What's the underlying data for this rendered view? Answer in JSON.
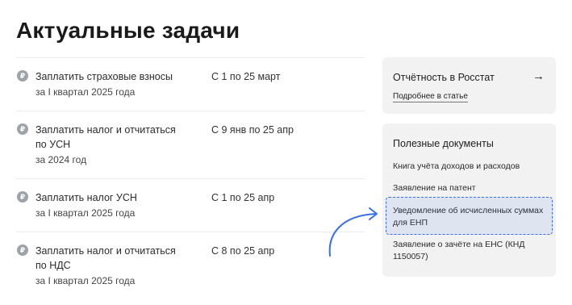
{
  "page": {
    "title": "Актуальные задачи"
  },
  "tasks": [
    {
      "title": "Заплатить страховые взносы",
      "subtitle": "за I квартал 2025 года",
      "deadline": "С 1 по 25 март"
    },
    {
      "title": "Заплатить налог и отчитаться по УСН",
      "subtitle": "за 2024 год",
      "deadline": "С 9 янв по 25 апр"
    },
    {
      "title": "Заплатить налог УСН",
      "subtitle": "за I квартал 2025 года",
      "deadline": "С 1 по 25 апр"
    },
    {
      "title": "Заплатить налог и отчитаться по НДС",
      "subtitle": "за I квартал 2025 года",
      "deadline": "С 8 по 25 апр"
    }
  ],
  "task_icon_glyph": "₽",
  "report_card": {
    "title": "Отчётность в Росстат",
    "link": "Подробнее в статье",
    "arrow": "→"
  },
  "docs_card": {
    "title": "Полезные документы",
    "items": [
      "Книга учёта доходов и расходов",
      "Заявление на патент",
      "Уведомление об исчисленных суммах для ЕНП",
      "Заявление о зачёте на ЕНС (КНД 1150057)"
    ]
  },
  "colors": {
    "accent": "#3a6fe8",
    "card_bg": "#f2f2f2",
    "icon_bg": "#9ea3a9"
  }
}
